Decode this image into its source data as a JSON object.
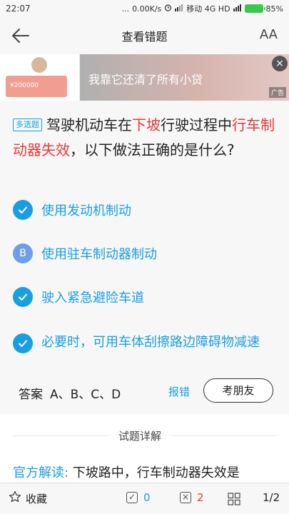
{
  "status_bar": {
    "time": "22:07",
    "dots": "...",
    "network_speed": "0.00K/s",
    "carrier": "移动 4G HD",
    "battery": "85%"
  },
  "nav": {
    "title": "查看错题",
    "back_icon": "back-arrow-icon",
    "font_icon": "font-size-icon",
    "font_glyph": "AA"
  },
  "ad": {
    "banner_text": "我靠它还清了所有小贷",
    "thumb_amount": "¥200000",
    "ad_label": "广告",
    "close_glyph": "×"
  },
  "question": {
    "type_label": "多选题",
    "parts": [
      {
        "text": "驾驶机动车在",
        "red": false
      },
      {
        "text": "下坡",
        "red": true
      },
      {
        "text": "行驶过程中",
        "red": false
      },
      {
        "text": "行车制动器失效",
        "red": true
      },
      {
        "text": "，以下做法正确的是什么?",
        "red": false
      }
    ]
  },
  "options": [
    {
      "mark": "check",
      "letter": "",
      "text": "使用发动机制动"
    },
    {
      "mark": "letter",
      "letter": "B",
      "text": "使用驻车制动器制动"
    },
    {
      "mark": "check",
      "letter": "",
      "text": "驶入紧急避险车道"
    },
    {
      "mark": "check",
      "letter": "",
      "text": "必要时，可用车体刮擦路边障碍物减速"
    }
  ],
  "answer": {
    "label": "答案",
    "value": "A、B、C、D",
    "report_label": "报错",
    "friend_button": "考朋友"
  },
  "explanation": {
    "title": "试题详解",
    "official_label": "官方解读:",
    "official_text": "下坡路中，行车制动器失效是"
  },
  "bottom_bar": {
    "favorite_label": "收藏",
    "correct_count": "0",
    "wrong_count": "2",
    "wrong_glyph": "×",
    "correct_glyph": "✓",
    "page": "1/2"
  },
  "colors": {
    "accent": "#1a9ee3",
    "highlight_red": "#e53935",
    "battery_green": "#39c94a"
  }
}
